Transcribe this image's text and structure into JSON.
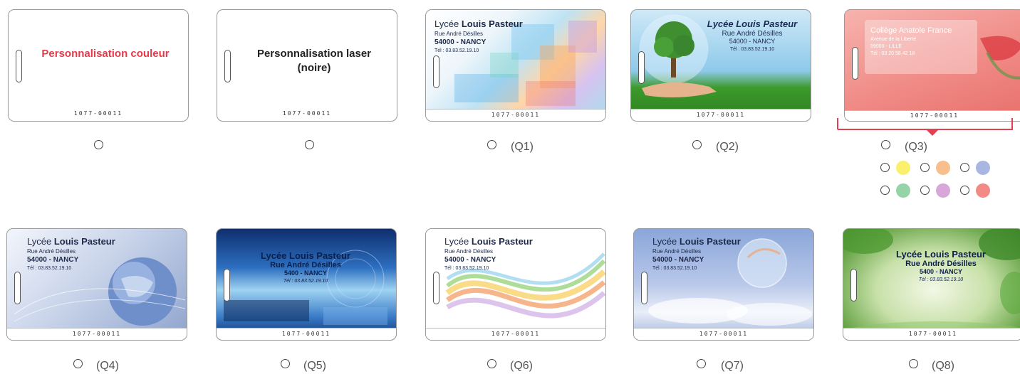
{
  "options": [
    {
      "code": "1077-00011",
      "title": "Personnalisation couleur",
      "title_color": "#e8394a"
    },
    {
      "code": "1077-00011",
      "title": "Personnalisation laser (noire)",
      "title_color": "#222222"
    }
  ],
  "models": [
    {
      "label": "(Q1)",
      "code": "1077-00011",
      "lines": [
        "Lycée",
        "Louis Pasteur",
        "Rue André Désilles",
        "54000 - NANCY",
        "Tél : 03.83.52.19.10"
      ]
    },
    {
      "label": "(Q2)",
      "code": "1077-00011",
      "lines": [
        "Lycée Louis Pasteur",
        "Rue André Désilles",
        "54000 - NANCY",
        "Tél : 03.83.52.19.10"
      ]
    },
    {
      "label": "(Q3)",
      "code": "1077-00011",
      "lines": [
        "Collège Anatole France",
        "Avenue de la Liberté",
        "59000 - LILLE",
        "Tél : 03 20 56 42 18"
      ]
    },
    {
      "label": "(Q4)",
      "code": "1077-00011",
      "lines": [
        "Lycée",
        "Louis Pasteur",
        "Rue André Désilles",
        "54000 - NANCY",
        "Tél : 03.83.52.19.10"
      ]
    },
    {
      "label": "(Q5)",
      "code": "1077-00011",
      "lines": [
        "Lycée Louis Pasteur",
        "Rue André Désilles",
        "5400 - NANCY",
        "Tél : 03.83.52.19.10"
      ]
    },
    {
      "label": "(Q6)",
      "code": "1077-00011",
      "lines": [
        "Lycée",
        "Louis Pasteur",
        "Rue André Désilles",
        "54000 - NANCY",
        "Tél : 03.83.52.19.10"
      ]
    },
    {
      "label": "(Q7)",
      "code": "1077-00011",
      "lines": [
        "Lycée",
        "Louis Pasteur",
        "Rue André Désilles",
        "54000 - NANCY",
        "Tél : 03.83.52.19.10"
      ]
    },
    {
      "label": "(Q8)",
      "code": "1077-00011",
      "lines": [
        "Lycée Louis Pasteur",
        "Rue André Désilles",
        "5400 - NANCY",
        "Tél : 03.83.52.19.10"
      ]
    }
  ],
  "q3_colors": [
    "#fbf06e",
    "#f9be8e",
    "#a9b6e2",
    "#94d4a7",
    "#d9a6d8",
    "#f28a86"
  ],
  "accent": "#e04050"
}
